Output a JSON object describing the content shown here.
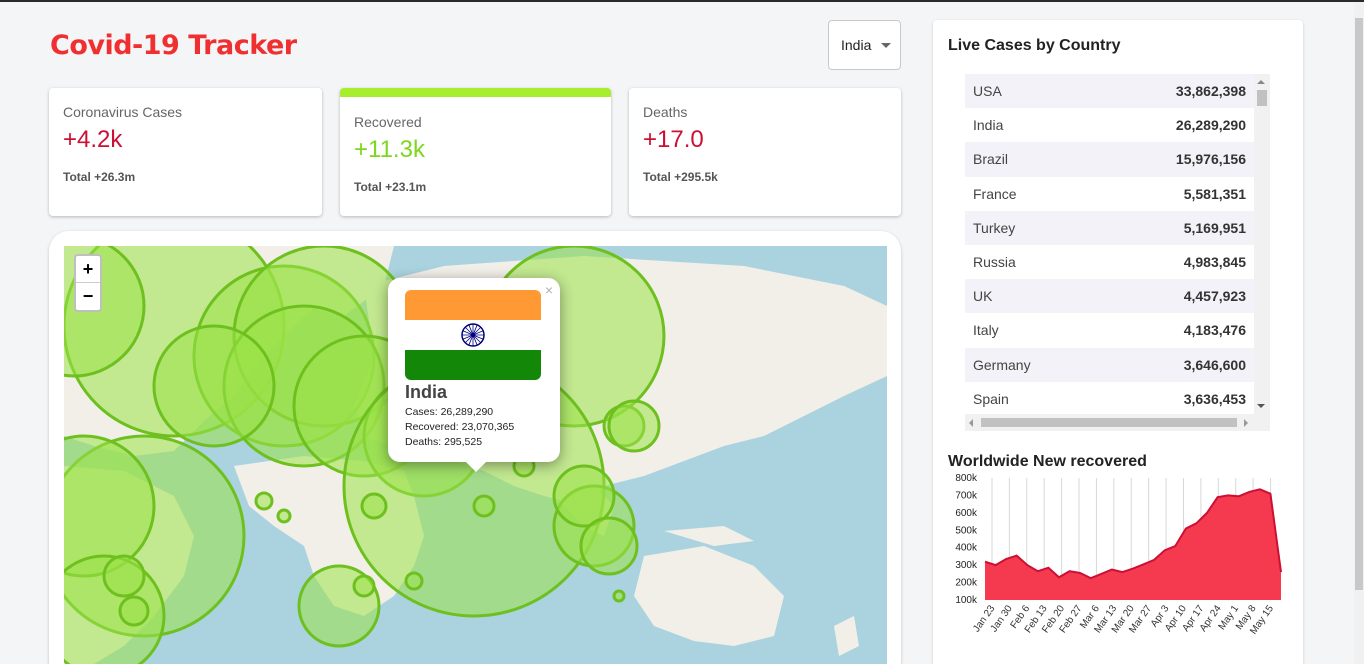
{
  "app_title": "Covid-19 Tracker",
  "country_select": {
    "value": "India"
  },
  "cards": {
    "cases": {
      "label": "Coronavirus Cases",
      "value": "+4.2k",
      "total": "Total +26.3m"
    },
    "recovered": {
      "label": "Recovered",
      "value": "+11.3k",
      "total": "Total +23.1m"
    },
    "deaths": {
      "label": "Deaths",
      "value": "+17.0",
      "total": "Total +295.5k"
    }
  },
  "map": {
    "zoom_in": "+",
    "zoom_out": "−",
    "popup": {
      "close": "×",
      "country": "India",
      "cases": "Cases: 26,289,290",
      "recovered": "Recovered: 23,070,365",
      "deaths": "Deaths: 295,525"
    }
  },
  "live_cases": {
    "title": "Live Cases by Country",
    "rows": [
      {
        "country": "USA",
        "cases": "33,862,398"
      },
      {
        "country": "India",
        "cases": "26,289,290"
      },
      {
        "country": "Brazil",
        "cases": "15,976,156"
      },
      {
        "country": "France",
        "cases": "5,581,351"
      },
      {
        "country": "Turkey",
        "cases": "5,169,951"
      },
      {
        "country": "Russia",
        "cases": "4,983,845"
      },
      {
        "country": "UK",
        "cases": "4,457,923"
      },
      {
        "country": "Italy",
        "cases": "4,183,476"
      },
      {
        "country": "Germany",
        "cases": "3,646,600"
      },
      {
        "country": "Spain",
        "cases": "3,636,453"
      }
    ]
  },
  "colors": {
    "title": "#f03030",
    "red": "#cc1034",
    "green": "#7dd71d",
    "circle": "#7dd71d",
    "chart_fill": "#f5394f",
    "chart_line": "#cc1034"
  },
  "chart_data": {
    "type": "area",
    "title": "Worldwide New recovered",
    "x": [
      "Jan 23",
      "Jan 30",
      "Feb 6",
      "Feb 13",
      "Feb 20",
      "Feb 27",
      "Mar 6",
      "Mar 13",
      "Mar 20",
      "Mar 27",
      "Apr 3",
      "Apr 10",
      "Apr 17",
      "Apr 24",
      "May 1",
      "May 8",
      "May 15"
    ],
    "yticks": [
      "800k",
      "700k",
      "600k",
      "500k",
      "400k",
      "300k",
      "200k",
      "100k"
    ],
    "ylim": [
      100000,
      800000
    ],
    "grid": "vertical",
    "values": [
      320000,
      300000,
      335000,
      355000,
      300000,
      265000,
      285000,
      230000,
      265000,
      255000,
      225000,
      250000,
      275000,
      260000,
      280000,
      305000,
      330000,
      385000,
      410000,
      510000,
      540000,
      600000,
      690000,
      700000,
      695000,
      720000,
      735000,
      710000,
      260000
    ]
  }
}
